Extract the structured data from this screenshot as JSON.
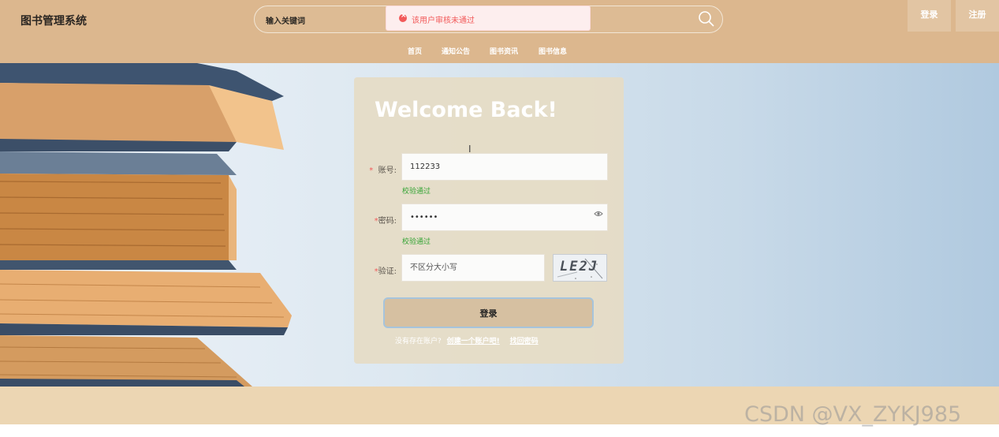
{
  "header": {
    "brand": "图书管理系统",
    "search_placeholder": "输入关键词",
    "login_label": "登录",
    "register_label": "注册",
    "nav": [
      "首页",
      "通知公告",
      "图书资讯",
      "图书信息"
    ]
  },
  "toast": {
    "message": "该用户审核未通过",
    "icon": "error-circle-icon",
    "color": "#f25a5a"
  },
  "login_form": {
    "title": "Welcome Back!",
    "account_label": "账号:",
    "account_value": "112233",
    "account_status": "校验通过",
    "password_label": "密码:",
    "password_value": "••••••",
    "password_status": "校验通过",
    "captcha_label": "验证:",
    "captcha_placeholder": "不区分大小写",
    "captcha_image_text": "LE2J",
    "submit_label": "登录",
    "no_account_text": "没有存在账户?",
    "create_account_link": "创建一个账户吧!",
    "forgot_password_link": "找回密码"
  },
  "colors": {
    "header_bg": "#dcb78e",
    "accent_btn": "#d6c0a1",
    "valid_green": "#35a435",
    "required_red": "#f25a5a"
  },
  "watermark": "CSDN @VX_ZYKJ985"
}
